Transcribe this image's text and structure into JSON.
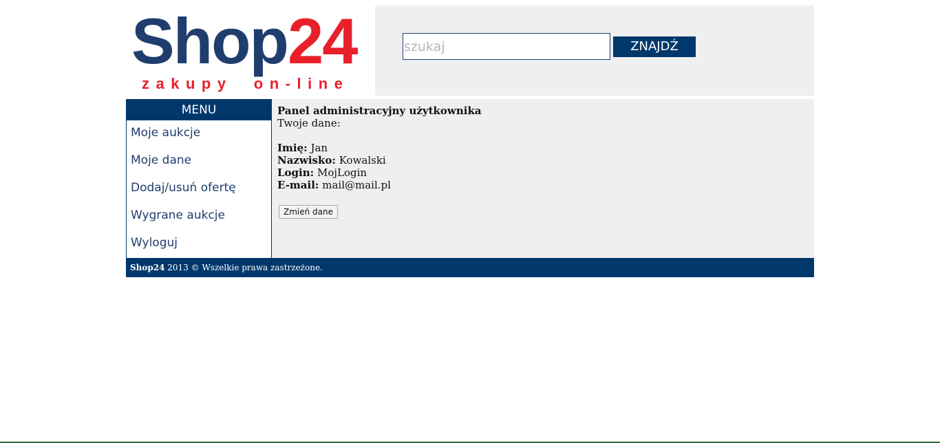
{
  "logo": {
    "brand_shop": "Shop",
    "brand_number": "24",
    "tagline": "zakupy  on-line",
    "colors": {
      "navy": "#1f3e6e",
      "red": "#e8202a"
    }
  },
  "search": {
    "placeholder": "szukaj",
    "value": "",
    "button_label": "ZNAJDŹ"
  },
  "sidebar": {
    "menu_title": "MENU",
    "items": [
      {
        "label": "Moje aukcje"
      },
      {
        "label": "Moje dane"
      },
      {
        "label": "Dodaj/usuń ofertę"
      },
      {
        "label": "Wygrane aukcje"
      },
      {
        "label": "Wyloguj"
      }
    ]
  },
  "content": {
    "title": "Panel administracyjny użytkownika",
    "subtitle": "Twoje dane:",
    "fields": [
      {
        "label": "Imię:",
        "value": "Jan"
      },
      {
        "label": "Nazwisko:",
        "value": "Kowalski"
      },
      {
        "label": "Login:",
        "value": "MojLogin"
      },
      {
        "label": "E-mail:",
        "value": "mail@mail.pl"
      }
    ],
    "change_button_label": "Zmień dane"
  },
  "footer": {
    "brand": "Shop24",
    "text": " 2013 © Wszelkie prawa zastrzeżone."
  },
  "colors": {
    "primary": "#00386c",
    "panel_background": "#efefef",
    "accent_red": "#e8202a"
  }
}
